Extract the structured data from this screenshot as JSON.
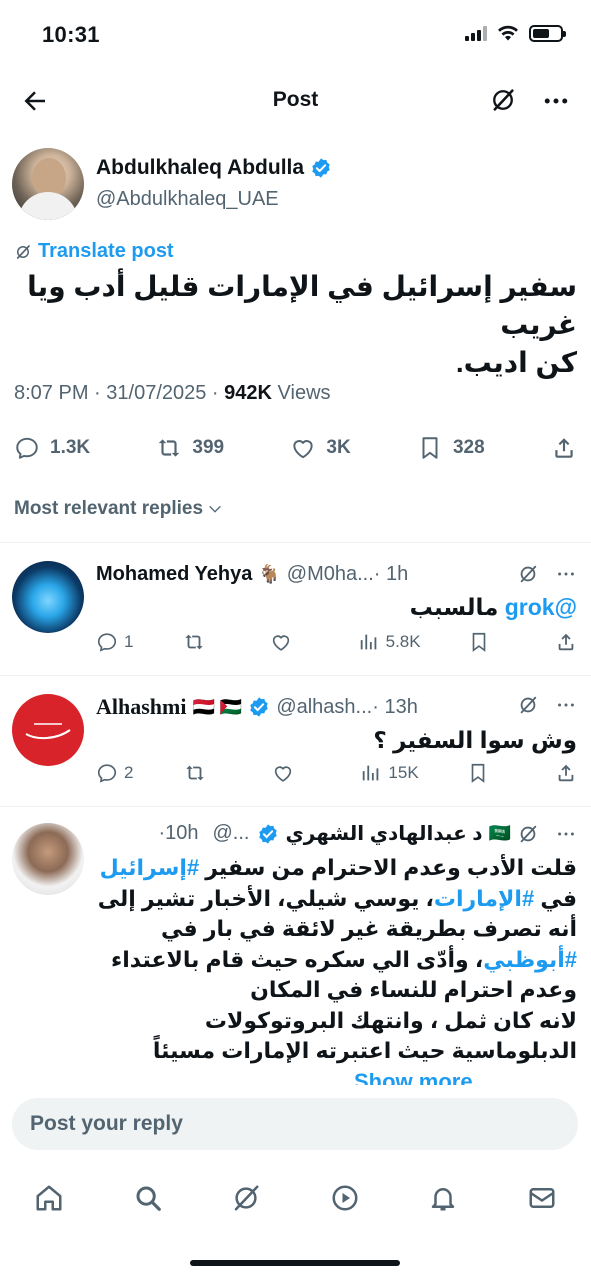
{
  "status": {
    "time": "10:31"
  },
  "header": {
    "title": "Post"
  },
  "post": {
    "author_name": "Abdulkhaleq Abdulla",
    "author_handle": "@Abdulkhaleq_UAE",
    "translate_label": "Translate post",
    "text_line1": "سفير إسرائيل في الإمارات قليل أدب ويا غريب",
    "text_line2": "كن اديب.",
    "time": "8:07 PM",
    "date": "31/07/2025",
    "views": "942K",
    "views_label": "Views",
    "stats": {
      "replies": "1.3K",
      "reposts": "399",
      "likes": "3K",
      "bookmarks": "328"
    }
  },
  "sort_label": "Most relevant replies",
  "replies": [
    {
      "name": "Mohamed Yehya",
      "flag": "🐐",
      "handle": "@M0ha...",
      "time": "· 1h",
      "mention": "@grok",
      "text": "مالسبب",
      "comments": "1",
      "views": "5.8K"
    },
    {
      "name": "Alhashmi",
      "flag": "🇾🇪 🇵🇸",
      "handle": "@alhash...",
      "time": "· 13h",
      "text": "وش سوا السفير ؟",
      "comments": "2",
      "views": "15K"
    },
    {
      "name": "د عبدالهادي الشهري",
      "flag": "🇸🇦",
      "handle": "@...",
      "time": "·10h",
      "text_lines": [
        {
          "plain": "قلت الأدب وعدم الاحترام من سفير ",
          "tag": "#إسرائيل"
        },
        {
          "pre": "في ",
          "tag": "#الإمارات",
          "plain": "، يوسي شيلي، الأخبار تشير إلى"
        },
        {
          "plain": "أنه  تصرف بطريقة غير لائقة في بار في"
        },
        {
          "tag": "#أبوظبي",
          "plain": "، وأدّى الي سكره حيث قام بالاعتداء"
        },
        {
          "plain": "وعدم احترام للنساء في المكان"
        },
        {
          "plain": "لانه كان ثمل ، وانتهك البروتوكولات"
        },
        {
          "plain": "الدبلوماسية حيث اعتبرته الإمارات مسيئاً"
        }
      ],
      "show_more": "Show more"
    }
  ],
  "reply_bar": {
    "placeholder": "Post your reply"
  },
  "colors": {
    "accent": "#1d9bf0",
    "muted": "#536471",
    "text": "#0f1419"
  }
}
